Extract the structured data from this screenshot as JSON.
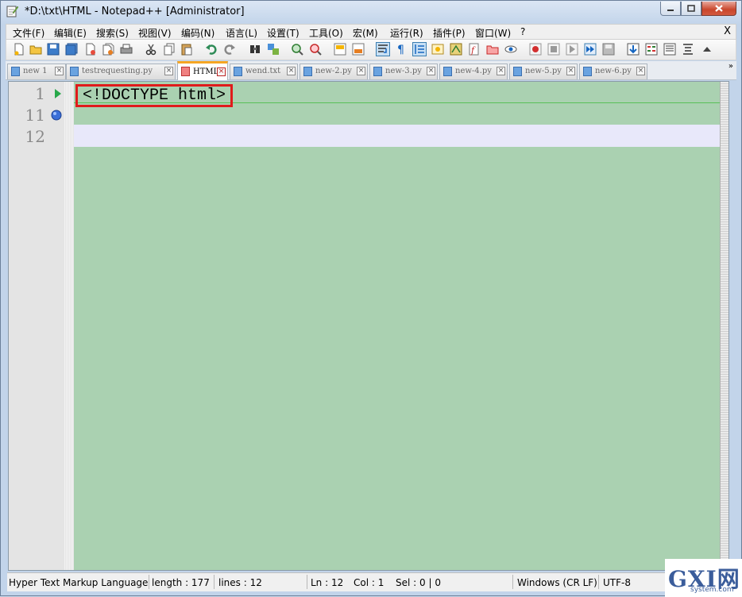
{
  "window": {
    "title": "*D:\\txt\\HTML - Notepad++ [Administrator]"
  },
  "menu": {
    "items": [
      "文件(F)",
      "编辑(E)",
      "搜索(S)",
      "视图(V)",
      "编码(N)",
      "语言(L)",
      "设置(T)",
      "工具(O)",
      "宏(M)",
      "运行(R)",
      "插件(P)",
      "窗口(W)",
      "?"
    ],
    "close": "X"
  },
  "toolbar": {
    "icons": [
      "new-file-icon",
      "open-file-icon",
      "save-icon",
      "save-all-icon",
      "close-icon",
      "close-all-icon",
      "print-icon",
      "cut-icon",
      "copy-icon",
      "paste-icon",
      "undo-icon",
      "redo-icon",
      "find-icon",
      "replace-icon",
      "zoom-in-icon",
      "zoom-out-icon",
      "sync-v-icon",
      "sync-h-icon",
      "word-wrap-icon",
      "show-all-chars-icon",
      "indent-guide-icon",
      "user-lang-icon",
      "doc-map-icon",
      "function-list-icon",
      "folder-workspace-icon",
      "monitor-icon",
      "record-macro-icon",
      "stop-macro-icon",
      "play-macro-icon",
      "run-macro-multi-icon",
      "save-macro-icon",
      "upload-icon",
      "compare-icon",
      "doc-list-icon",
      "panel-icon",
      "arrow-up-icon"
    ]
  },
  "tabs": [
    {
      "label": "new 1",
      "active": false
    },
    {
      "label": "testrequesting.py",
      "active": false
    },
    {
      "label": "HTML",
      "active": true
    },
    {
      "label": "wend.txt",
      "active": false
    },
    {
      "label": "new-2.py",
      "active": false
    },
    {
      "label": "new-3.py",
      "active": false
    },
    {
      "label": "new-4.py",
      "active": false
    },
    {
      "label": "new-5.py",
      "active": false
    },
    {
      "label": "new-6.py",
      "active": false
    }
  ],
  "editor": {
    "line_numbers": [
      "1",
      "11",
      "12"
    ],
    "first_line": "<!DOCTYPE html>",
    "colors": {
      "background": "#aad1b1",
      "current_line": "#e8e8fa",
      "highlight_box": "#e01b1b"
    }
  },
  "status": {
    "language": "Hyper Text Markup Language",
    "length": "length : 177",
    "lines": "lines : 12",
    "ln": "Ln : 12",
    "col": "Col : 1",
    "sel": "Sel : 0 | 0",
    "eol": "Windows (CR LF)",
    "encoding": "UTF-8"
  },
  "watermark": {
    "logo": "GXI网",
    "site": "system.com"
  }
}
